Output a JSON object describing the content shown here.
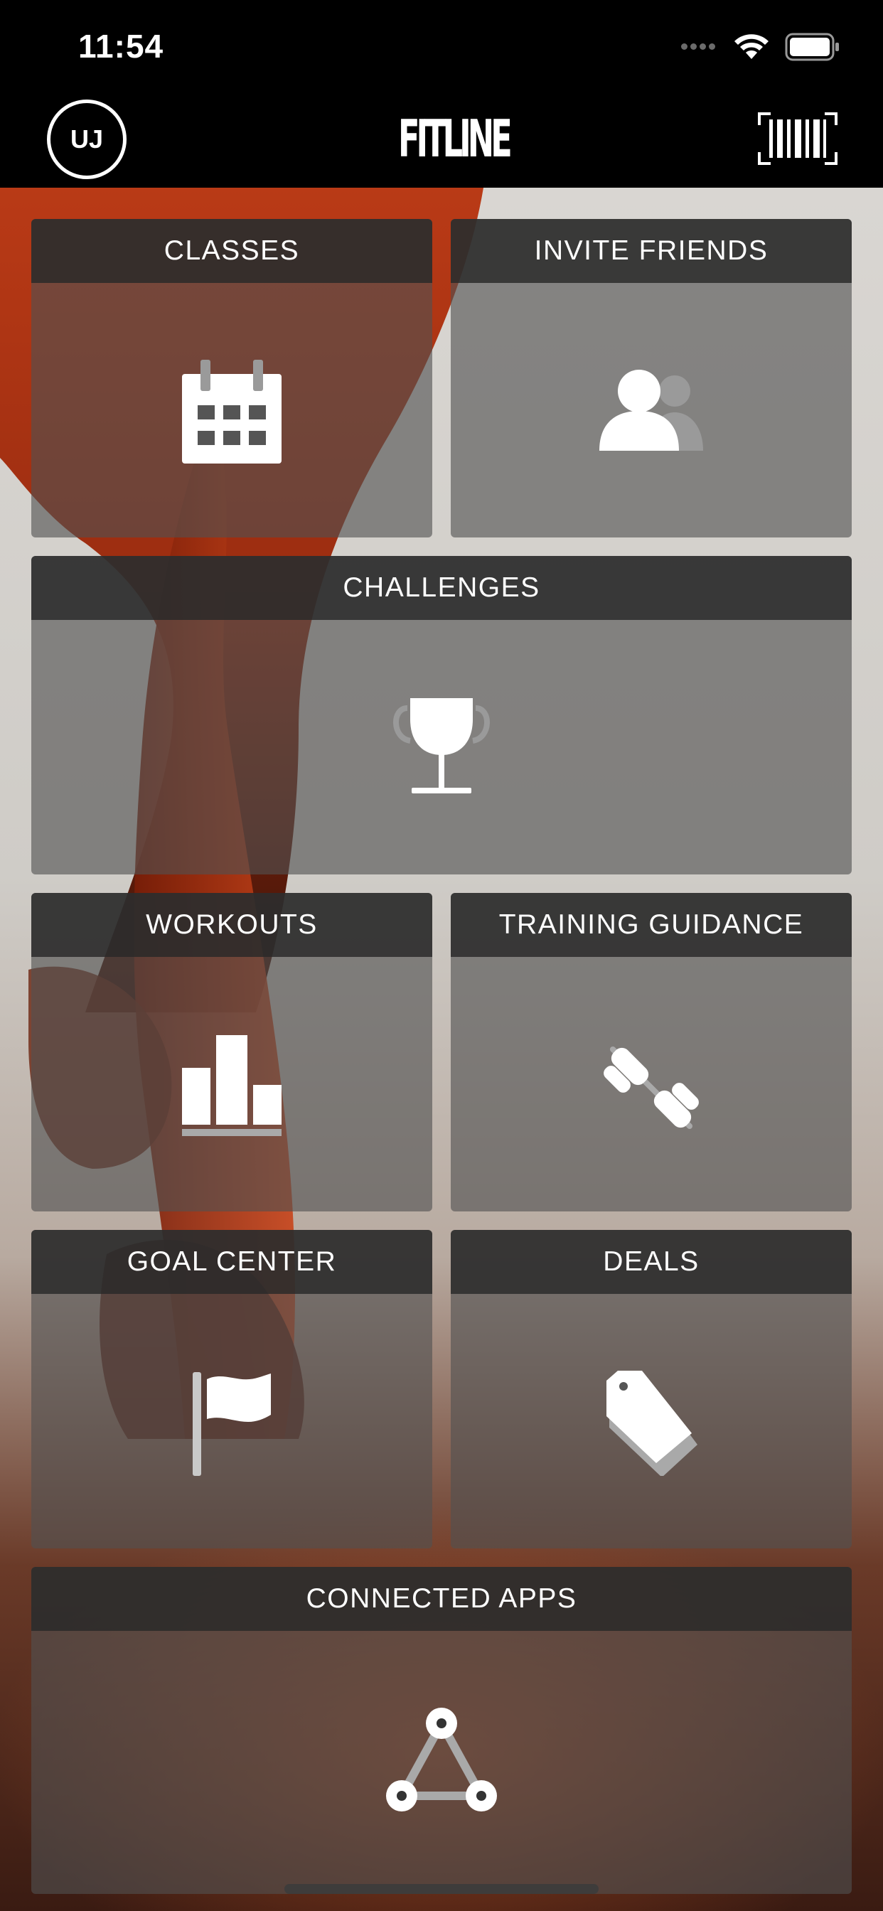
{
  "status_bar": {
    "time": "11:54"
  },
  "nav": {
    "avatar_initials": "UJ",
    "logo_text": "FITLINE"
  },
  "tiles": {
    "classes": "CLASSES",
    "invite_friends": "INVITE FRIENDS",
    "challenges": "CHALLENGES",
    "workouts": "WORKOUTS",
    "training_guidance": "TRAINING GUIDANCE",
    "goal_center": "GOAL CENTER",
    "deals": "DEALS",
    "connected_apps": "CONNECTED APPS"
  },
  "colors": {
    "tile_body": "#555555",
    "tile_header": "#282828",
    "icon": "#ffffff",
    "accent_background": "#c8401a"
  }
}
